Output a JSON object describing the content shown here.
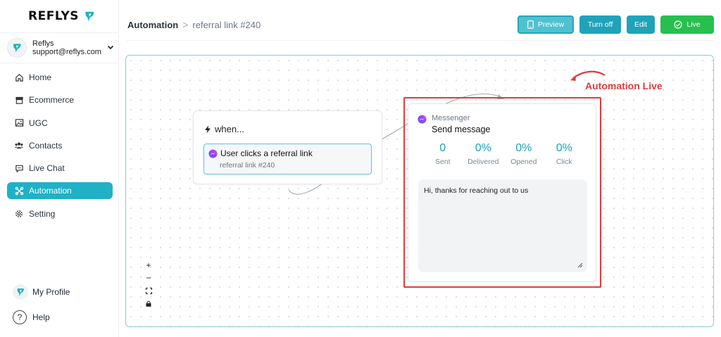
{
  "brand": {
    "name": "REFLYS",
    "accent": "#1fb1c6"
  },
  "account": {
    "name": "Reflys",
    "email": "support@reflys.com"
  },
  "nav": {
    "items": [
      {
        "label": "Home",
        "icon": "home-icon"
      },
      {
        "label": "Ecommerce",
        "icon": "store-icon"
      },
      {
        "label": "UGC",
        "icon": "image-icon"
      },
      {
        "label": "Contacts",
        "icon": "contacts-icon"
      },
      {
        "label": "Live Chat",
        "icon": "chat-icon"
      },
      {
        "label": "Automation",
        "icon": "automation-icon",
        "active": true
      },
      {
        "label": "Setting",
        "icon": "gear-icon"
      }
    ]
  },
  "footer": {
    "profile": "My Profile",
    "help": "Help",
    "help_icon": "?"
  },
  "breadcrumb": {
    "root": "Automation",
    "separator": ">",
    "current": "referral link #240"
  },
  "toolbar": {
    "preview": "Preview",
    "turn_off": "Turn off",
    "edit": "Edit",
    "live": "Live"
  },
  "trigger_card": {
    "title": "when...",
    "trigger_title": "User clicks a referral link",
    "trigger_subtitle": "referral link #240"
  },
  "message_card": {
    "channel": "Messenger",
    "action": "Send message",
    "stats": [
      {
        "value": "0",
        "label": "Sent"
      },
      {
        "value": "0%",
        "label": "Delivered"
      },
      {
        "value": "0%",
        "label": "Opened"
      },
      {
        "value": "0%",
        "label": "Click"
      }
    ],
    "text": "Hi, thanks for reaching out to us"
  },
  "annotation": {
    "text": "Automation Live",
    "color": "#e23b3b"
  },
  "zoom_controls": {
    "zoom_in": "+",
    "zoom_out": "−"
  }
}
